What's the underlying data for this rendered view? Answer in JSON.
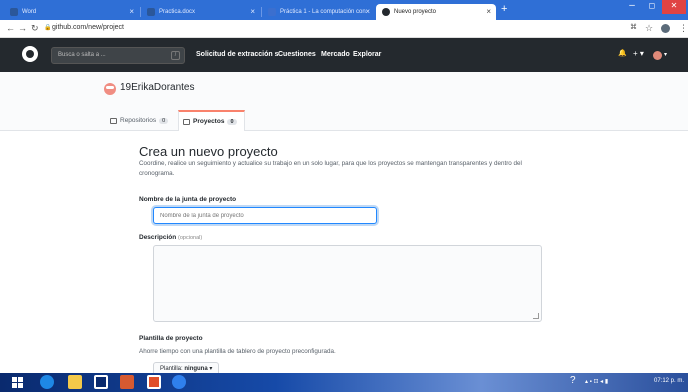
{
  "browser": {
    "tabs": [
      {
        "label": "Word",
        "favicon_color": "#2b579a"
      },
      {
        "label": "Practica.docx",
        "favicon_color": "#2b579a"
      },
      {
        "label": "Práctica 1 - La computación con",
        "favicon_color": "#3b6fcf"
      },
      {
        "label": "Nuevo proyecto",
        "favicon_color": "#24292e",
        "active": true
      }
    ],
    "new_tab": "+",
    "window_controls": {
      "minimize": "–",
      "maximize": "◻",
      "close": "✕"
    },
    "url": "github.com/new/project"
  },
  "github_header": {
    "search_placeholder": "Busca o salta a ...",
    "search_shortcut": "/",
    "nav": [
      "Solicitud de extracción s",
      "Cuestiones",
      "Mercado",
      "Explorar"
    ],
    "bell": "🔔",
    "plus": "+ ▾",
    "avatar_caret": "▾"
  },
  "profile": {
    "username": "19ErikaDorantes",
    "tabs": [
      {
        "label": "Repositorios",
        "count": "0"
      },
      {
        "label": "Proyectos",
        "count": "0",
        "selected": true
      }
    ]
  },
  "form": {
    "title": "Crea un nuevo proyecto",
    "description": "Coordine, realice un seguimiento y actualice su trabajo en un solo lugar, para que los proyectos se mantengan transparentes y dentro del cronograma.",
    "name_label": "Nombre de la junta de proyecto",
    "name_placeholder": "Nombre de la junta de proyecto",
    "desc_label": "Descripción",
    "desc_optional": "(opcional)",
    "template_label": "Plantilla de proyecto",
    "template_sub": "Ahorre tiempo con una plantilla de tablero de proyecto preconfigurada.",
    "template_button_prefix": "Plantilla:",
    "template_button_value": "ninguna",
    "template_caret": "▾"
  },
  "taskbar": {
    "tray_time": "07:12 p. m."
  },
  "colors": {
    "tab_strip": "#2f6fd6",
    "gh_header": "#24292e",
    "focus_blue": "#2188ff",
    "tab_accent": "#f9826c"
  }
}
